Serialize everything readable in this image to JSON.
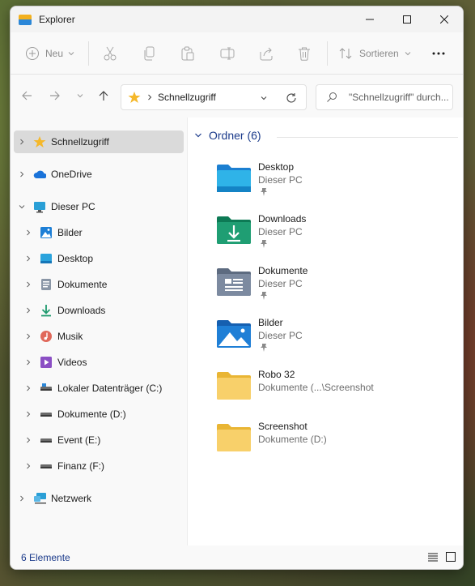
{
  "window": {
    "title": "Explorer"
  },
  "toolbar": {
    "new_label": "Neu",
    "sort_label": "Sortieren"
  },
  "address": {
    "path_segment": "Schnellzugriff"
  },
  "search": {
    "placeholder": "\"Schnellzugriff\" durch..."
  },
  "sidebar": {
    "items": [
      {
        "label": "Schnellzugriff",
        "icon": "star-icon"
      },
      {
        "label": "OneDrive",
        "icon": "cloud-icon"
      },
      {
        "label": "Dieser PC",
        "icon": "monitor-icon"
      },
      {
        "label": "Bilder",
        "icon": "pictures-icon"
      },
      {
        "label": "Desktop",
        "icon": "desktop-icon"
      },
      {
        "label": "Dokumente",
        "icon": "documents-icon"
      },
      {
        "label": "Downloads",
        "icon": "download-icon"
      },
      {
        "label": "Musik",
        "icon": "music-icon"
      },
      {
        "label": "Videos",
        "icon": "video-icon"
      },
      {
        "label": "Lokaler Datenträger (C:)",
        "icon": "drive-icon"
      },
      {
        "label": "Dokumente (D:)",
        "icon": "drive-icon"
      },
      {
        "label": "Event (E:)",
        "icon": "drive-icon"
      },
      {
        "label": "Finanz (F:)",
        "icon": "drive-icon"
      },
      {
        "label": "Netzwerk",
        "icon": "network-icon"
      }
    ]
  },
  "main": {
    "group_title": "Ordner (6)",
    "folders": [
      {
        "name": "Desktop",
        "location": "Dieser PC",
        "pinned": true,
        "icon": "desktop-folder-icon"
      },
      {
        "name": "Downloads",
        "location": "Dieser PC",
        "pinned": true,
        "icon": "downloads-folder-icon"
      },
      {
        "name": "Dokumente",
        "location": "Dieser PC",
        "pinned": true,
        "icon": "documents-folder-icon"
      },
      {
        "name": "Bilder",
        "location": "Dieser PC",
        "pinned": true,
        "icon": "pictures-folder-icon"
      },
      {
        "name": "Robo 32",
        "location": "Dokumente (...\\Screenshot",
        "pinned": false,
        "icon": "folder-icon"
      },
      {
        "name": "Screenshot",
        "location": "Dokumente (D:)",
        "pinned": false,
        "icon": "folder-icon"
      }
    ]
  },
  "status": {
    "item_count": "6 Elemente"
  },
  "colors": {
    "accent": "#1a3a8a",
    "selected_bg": "#dadada",
    "folder_yellow": "#f5c84c"
  }
}
